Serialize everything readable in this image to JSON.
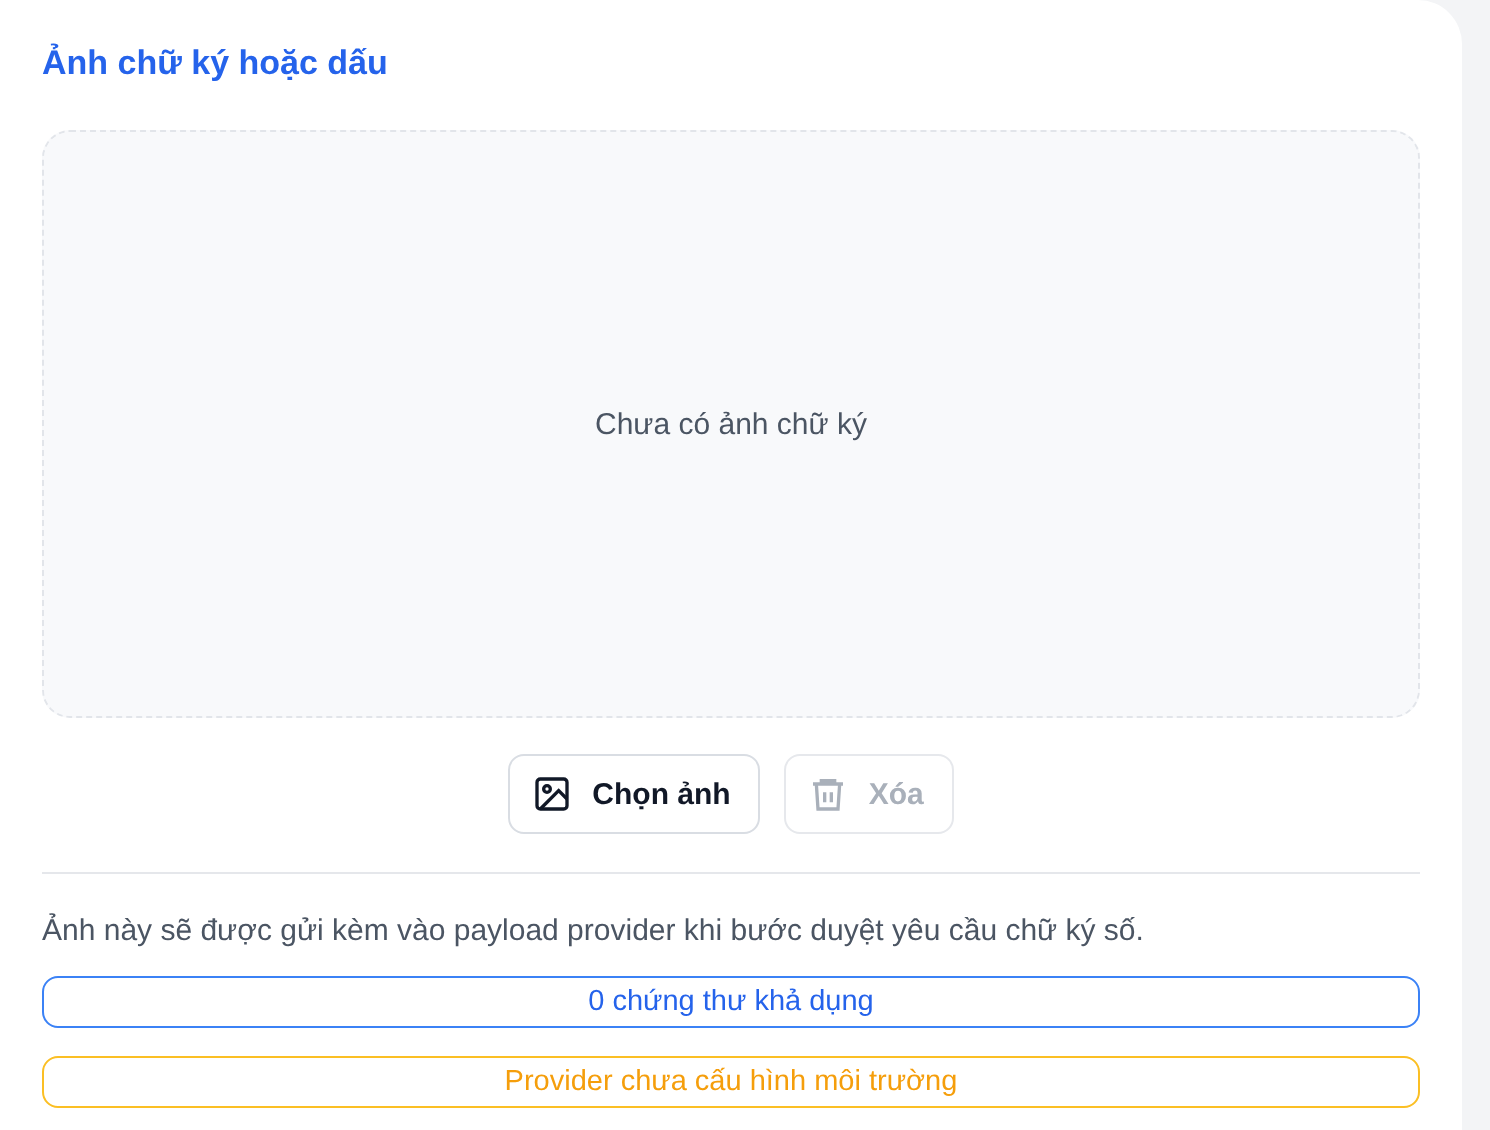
{
  "section": {
    "title": "Ảnh chữ ký hoặc dấu"
  },
  "dropzone": {
    "message": "Chưa có ảnh chữ ký"
  },
  "buttons": [
    {
      "kind": "image",
      "label": "Chọn ảnh",
      "disabled": false
    },
    {
      "kind": "trash",
      "label": "Xóa",
      "disabled": true
    }
  ],
  "note": "Ảnh này sẽ được gửi kèm vào payload provider khi bước duyệt yêu cầu chữ ký số.",
  "badges": [
    {
      "kind": "info",
      "label": "0 chứng thư khả dụng"
    },
    {
      "kind": "warning",
      "label": "Provider chưa cấu hình môi trường"
    }
  ]
}
